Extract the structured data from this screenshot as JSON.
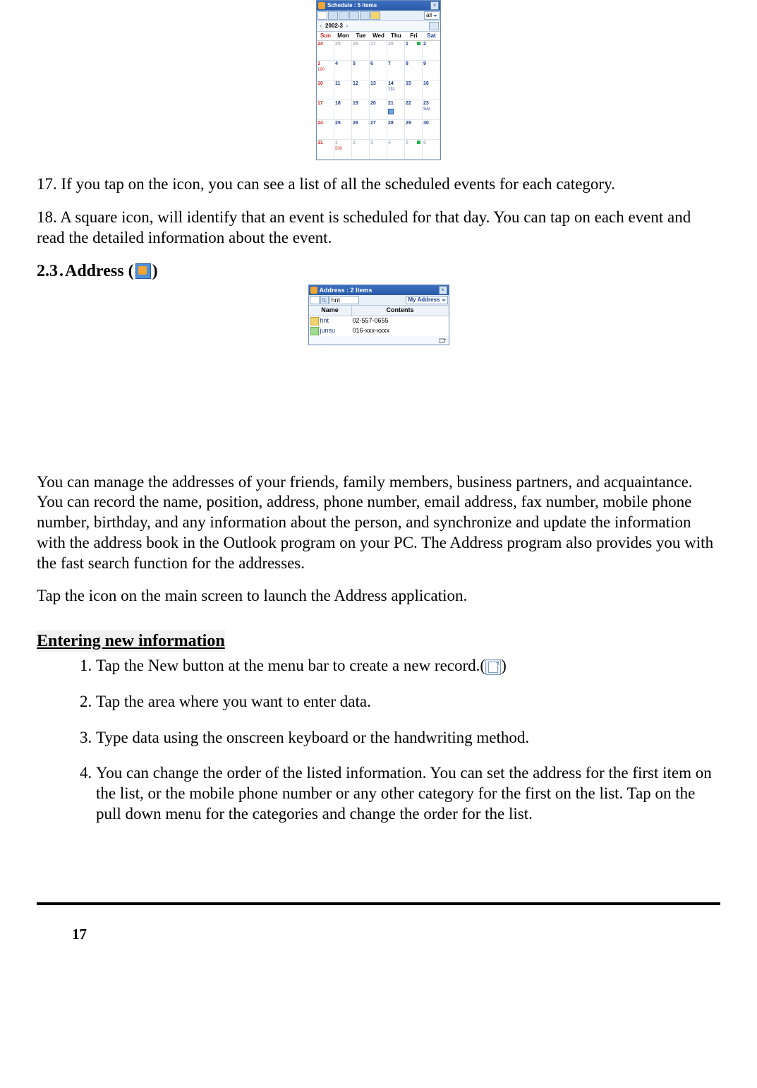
{
  "schedule_widget": {
    "title": "Schedule : 5 items",
    "filter": "all",
    "date": "2002-3",
    "dow": [
      "Sun",
      "Mon",
      "Tue",
      "Wed",
      "Thu",
      "Fri",
      "Sat"
    ],
    "rows": [
      [
        {
          "n": "24",
          "cls": "other sun"
        },
        {
          "n": "25",
          "cls": "other"
        },
        {
          "n": "26",
          "cls": "other"
        },
        {
          "n": "27",
          "cls": "other"
        },
        {
          "n": "28",
          "cls": "other"
        },
        {
          "n": "1",
          "dot": true
        },
        {
          "n": "2",
          "cls": "sat"
        }
      ],
      [
        {
          "n": "3",
          "cls": "sun",
          "sub": "190"
        },
        {
          "n": "4"
        },
        {
          "n": "5"
        },
        {
          "n": "6"
        },
        {
          "n": "7"
        },
        {
          "n": "8"
        },
        {
          "n": "9",
          "cls": "sat"
        }
      ],
      [
        {
          "n": "10",
          "cls": "sun"
        },
        {
          "n": "11"
        },
        {
          "n": "12"
        },
        {
          "n": "13"
        },
        {
          "n": "14",
          "subblue": "131"
        },
        {
          "n": "15"
        },
        {
          "n": "16",
          "cls": "sat"
        }
      ],
      [
        {
          "n": "17",
          "cls": "sun"
        },
        {
          "n": "18"
        },
        {
          "n": "19"
        },
        {
          "n": "20"
        },
        {
          "n": "21",
          "blk": true
        },
        {
          "n": "22"
        },
        {
          "n": "23",
          "cls": "sat",
          "subblue": "SAI"
        }
      ],
      [
        {
          "n": "24",
          "cls": "sun"
        },
        {
          "n": "25"
        },
        {
          "n": "26"
        },
        {
          "n": "27"
        },
        {
          "n": "28"
        },
        {
          "n": "29"
        },
        {
          "n": "30",
          "cls": "sat"
        }
      ],
      [
        {
          "n": "31",
          "cls": "sun"
        },
        {
          "n": "1",
          "cls": "other",
          "sub": "500"
        },
        {
          "n": "2",
          "cls": "other"
        },
        {
          "n": "3",
          "cls": "other"
        },
        {
          "n": "4",
          "cls": "other"
        },
        {
          "n": "5",
          "cls": "other",
          "dot": true
        },
        {
          "n": "6",
          "cls": "other"
        }
      ]
    ]
  },
  "text": {
    "p17": "17. If you tap on the icon,  you can see a list of all the scheduled events for each category.",
    "p18": "18. A square icon,  will identify that an event is scheduled for that day. You can tap on each event and read the detailed information about the event.",
    "sec_number": "2.3",
    "sec_dot": ".",
    "sec_label": " Address (",
    "sec_close": ")",
    "address_desc": "You can manage the addresses of your friends, family members, business partners, and acquaintance. You can record the name, position, address, phone number, email address, fax number, mobile phone number, birthday, and any information about the person, and synchronize and update the information with the address book in the Outlook program on your PC. The Address program also provides you with the fast search function for the addresses.",
    "address_launch": "Tap the icon on the main screen to launch the Address application.",
    "sub_heading": "Entering new information",
    "steps": [
      "Tap the New button at the menu bar to create a new record.(",
      "Tap the area where you want to enter data.",
      "Type data using the onscreen keyboard or the handwriting method.",
      "You can change the order of the listed information. You can set the address for the first item on the list, or the mobile phone number or any other category for the first on the list. Tap on the pull down menu for the categories and change the order for the list."
    ],
    "step1_close": ")"
  },
  "address_widget": {
    "title": "Address : 2 Items",
    "search_value": "hnt",
    "group": "My Address",
    "cols": {
      "name": "Name",
      "contents": "Contents"
    },
    "rows": [
      {
        "icon": "b",
        "name": "hnt",
        "contents": "02-557-0655"
      },
      {
        "icon": "g",
        "name": "junsu",
        "contents": "016-xxx-xxxx"
      }
    ]
  },
  "page_number": "17"
}
